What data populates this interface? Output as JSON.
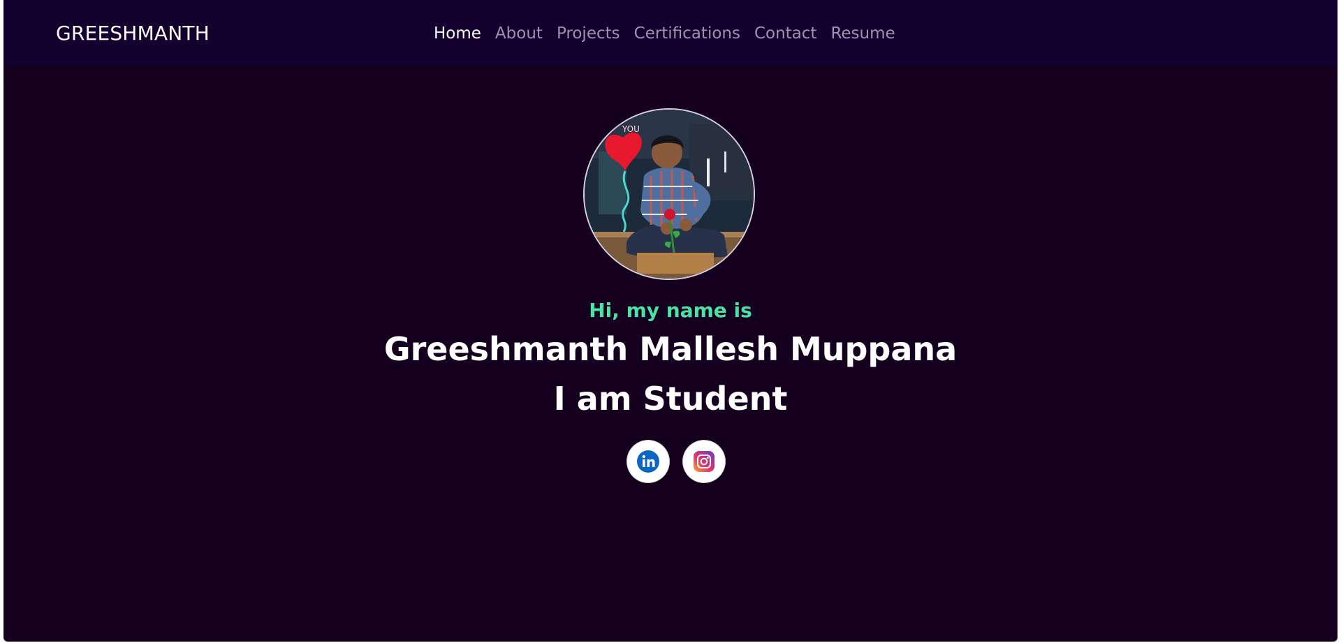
{
  "navbar": {
    "brand": "GREESHMANTH",
    "links": [
      {
        "label": "Home",
        "active": true
      },
      {
        "label": "About",
        "active": false
      },
      {
        "label": "Projects",
        "active": false
      },
      {
        "label": "Certifications",
        "active": false
      },
      {
        "label": "Contact",
        "active": false
      },
      {
        "label": "Resume",
        "active": false
      }
    ]
  },
  "hero": {
    "avatar_icon": "profile-photo",
    "greeting": "Hi, my name is",
    "name": "Greeshmanth Mallesh Muppana",
    "role": "I am Student",
    "socials": [
      {
        "icon": "linkedin-icon"
      },
      {
        "icon": "instagram-icon"
      }
    ]
  },
  "colors": {
    "page_bg": "#16001f",
    "navbar_bg": "#14002e",
    "accent_green": "#4be3a2",
    "nav_inactive": "#9c93b0",
    "linkedin_blue": "#0a66c2"
  }
}
